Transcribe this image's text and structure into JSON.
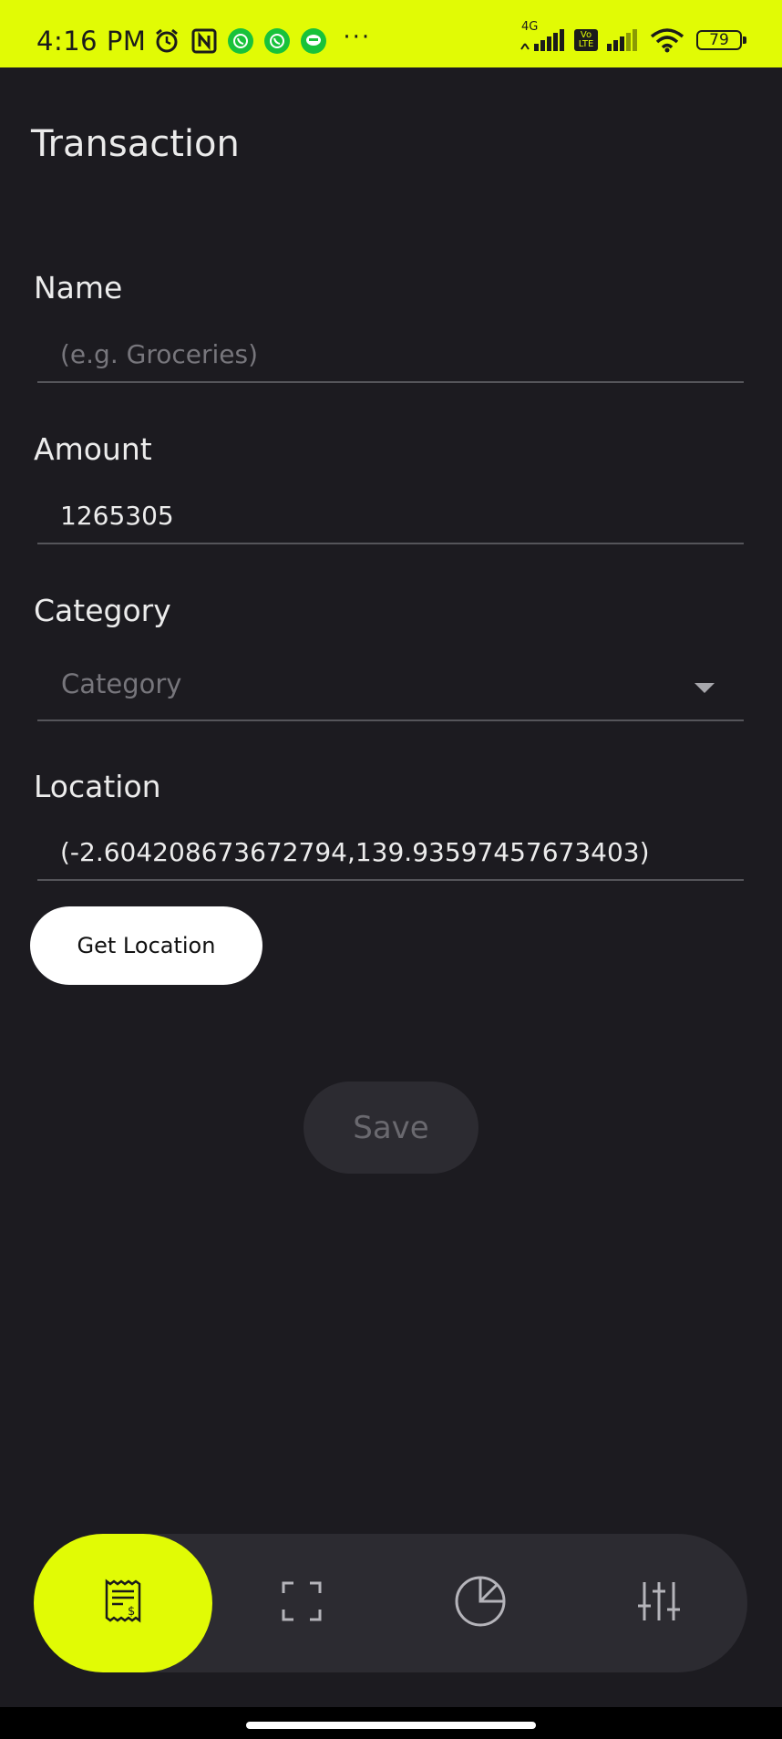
{
  "status_bar": {
    "time": "4:16 PM",
    "network_label": "4G",
    "volte_label": "Vo LTE",
    "battery_level": "79",
    "icons": [
      "alarm-icon",
      "nfc-icon",
      "whatsapp-icon",
      "whatsapp-icon",
      "line-icon",
      "more-dots-icon",
      "signal-icon",
      "wifi-icon",
      "battery-icon"
    ],
    "more_dots": "···"
  },
  "page": {
    "title": "Transaction"
  },
  "form": {
    "name": {
      "label": "Name",
      "value": "",
      "placeholder": "(e.g. Groceries)"
    },
    "amount": {
      "label": "Amount",
      "value": "1265305",
      "placeholder": ""
    },
    "category": {
      "label": "Category",
      "placeholder": "Category"
    },
    "location": {
      "label": "Location",
      "value": "(-2.604208673672794,139.93597457673403)"
    },
    "get_location_label": "Get Location",
    "save_label": "Save"
  },
  "bottom_nav": {
    "items": [
      {
        "icon": "receipt-icon",
        "active": true
      },
      {
        "icon": "scan-icon",
        "active": false
      },
      {
        "icon": "pie-chart-icon",
        "active": false
      },
      {
        "icon": "sliders-icon",
        "active": false
      }
    ]
  },
  "colors": {
    "accent": "#e1fb05",
    "background": "#1c1b20",
    "surface": "#2c2b31",
    "text": "#ebebeb",
    "muted": "#77767c"
  }
}
